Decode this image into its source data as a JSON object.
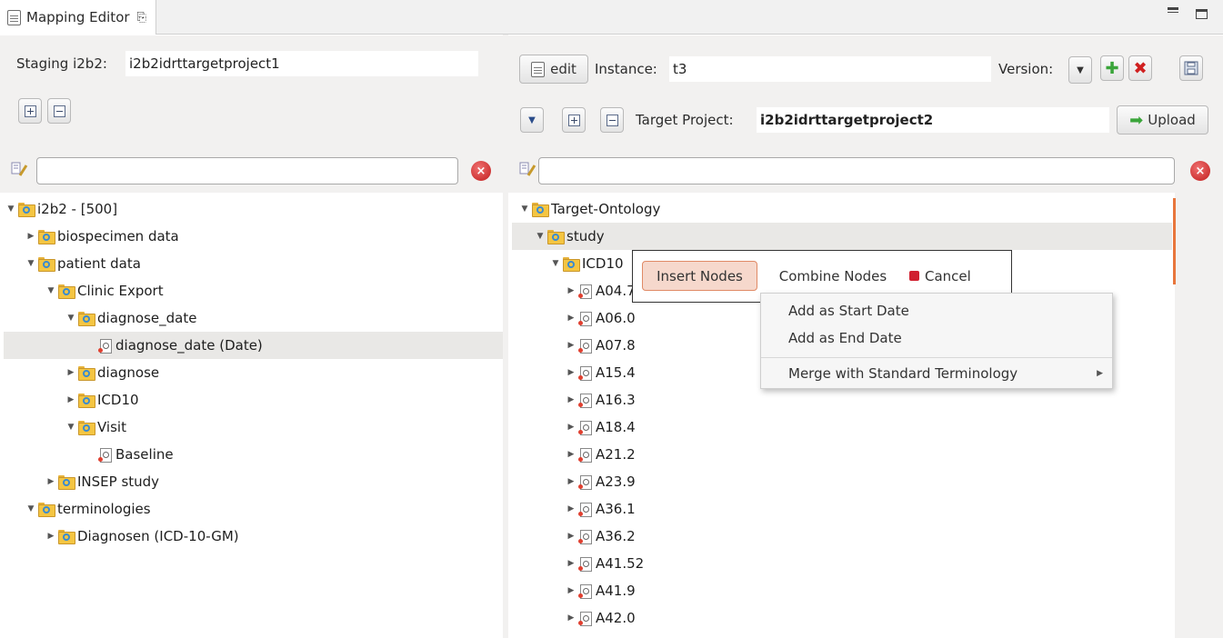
{
  "tab": {
    "title": "Mapping Editor",
    "close": "⎘"
  },
  "left": {
    "staging_label": "Staging i2b2:",
    "staging_value": "i2b2idrttargetproject1",
    "search_value": ""
  },
  "right": {
    "edit_label": "edit",
    "instance_label": "Instance:",
    "instance_value": "t3",
    "version_label": "Version:",
    "target_label": "Target Project:",
    "target_value": "i2b2idrttargetproject2",
    "upload_label": "Upload",
    "search_value": ""
  },
  "left_tree": [
    {
      "label": "i2b2 - [500]",
      "type": "folder",
      "expanded": true,
      "depth": 0
    },
    {
      "label": "biospecimen data",
      "type": "folder",
      "expanded": false,
      "depth": 1
    },
    {
      "label": "patient data",
      "type": "folder",
      "expanded": true,
      "depth": 1
    },
    {
      "label": "Clinic Export",
      "type": "folder",
      "expanded": true,
      "depth": 2
    },
    {
      "label": "diagnose_date",
      "type": "folder",
      "expanded": true,
      "depth": 3
    },
    {
      "label": "diagnose_date (Date)",
      "type": "leaf",
      "selected": true,
      "depth": 4
    },
    {
      "label": "diagnose",
      "type": "folder",
      "expanded": false,
      "depth": 3
    },
    {
      "label": "ICD10",
      "type": "folder",
      "expanded": false,
      "depth": 3
    },
    {
      "label": "Visit",
      "type": "folder",
      "expanded": true,
      "depth": 3
    },
    {
      "label": "Baseline",
      "type": "leaf",
      "depth": 4
    },
    {
      "label": "INSEP study",
      "type": "folder",
      "expanded": false,
      "depth": 2
    },
    {
      "label": "terminologies",
      "type": "folder",
      "expanded": true,
      "depth": 1
    },
    {
      "label": "Diagnosen (ICD-10-GM)",
      "type": "folder",
      "expanded": false,
      "depth": 2
    }
  ],
  "right_tree": [
    {
      "label": "Target-Ontology",
      "type": "folder",
      "expanded": true,
      "depth": 0
    },
    {
      "label": "study",
      "type": "folder",
      "expanded": true,
      "depth": 1,
      "selected": true
    },
    {
      "label": "ICD10",
      "type": "folder",
      "expanded": true,
      "depth": 2
    },
    {
      "label": "A04.7",
      "type": "leaf",
      "expandable": true,
      "depth": 3
    },
    {
      "label": "A06.0",
      "type": "leaf",
      "expandable": true,
      "depth": 3
    },
    {
      "label": "A07.8",
      "type": "leaf",
      "expandable": true,
      "depth": 3
    },
    {
      "label": "A15.4",
      "type": "leaf",
      "expandable": true,
      "depth": 3
    },
    {
      "label": "A16.3",
      "type": "leaf",
      "expandable": true,
      "depth": 3
    },
    {
      "label": "A18.4",
      "type": "leaf",
      "expandable": true,
      "depth": 3
    },
    {
      "label": "A21.2",
      "type": "leaf",
      "expandable": true,
      "depth": 3
    },
    {
      "label": "A23.9",
      "type": "leaf",
      "expandable": true,
      "depth": 3
    },
    {
      "label": "A36.1",
      "type": "leaf",
      "expandable": true,
      "depth": 3
    },
    {
      "label": "A36.2",
      "type": "leaf",
      "expandable": true,
      "depth": 3
    },
    {
      "label": "A41.52",
      "type": "leaf",
      "expandable": true,
      "depth": 3
    },
    {
      "label": "A41.9",
      "type": "leaf",
      "expandable": true,
      "depth": 3
    },
    {
      "label": "A42.0",
      "type": "leaf",
      "expandable": true,
      "depth": 3
    }
  ],
  "popup": {
    "insert": "Insert Nodes",
    "combine": "Combine Nodes",
    "cancel": "Cancel"
  },
  "menu": {
    "items": [
      "Add as Start Date",
      "Add as End Date",
      "Merge with Standard Terminology"
    ]
  }
}
